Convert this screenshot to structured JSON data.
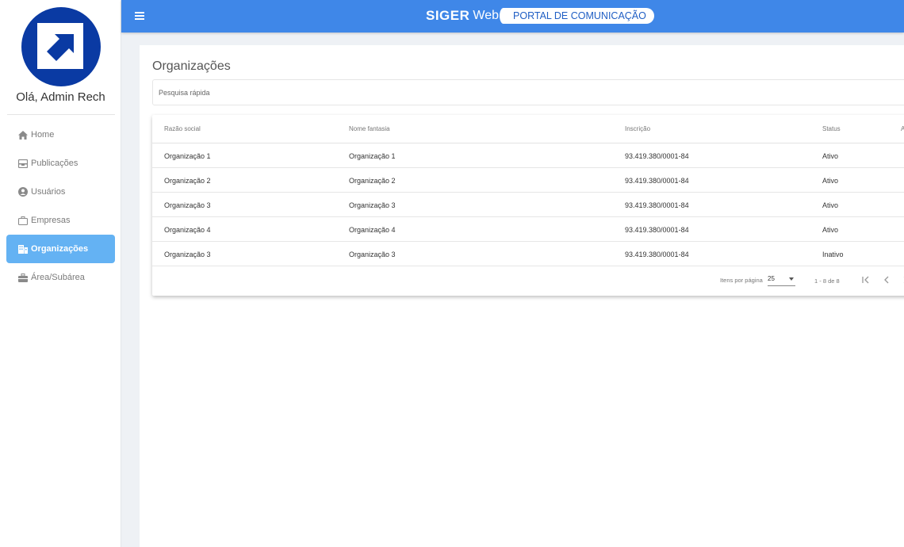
{
  "sidebar": {
    "greeting": "Olá, Admin Rech",
    "items": [
      {
        "label": "Home",
        "icon": "home-icon"
      },
      {
        "label": "Publicações",
        "icon": "inbox-icon"
      },
      {
        "label": "Usuários",
        "icon": "user-circle-icon"
      },
      {
        "label": "Empresas",
        "icon": "briefcase-icon"
      },
      {
        "label": "Organizações",
        "icon": "building-icon",
        "active": true
      },
      {
        "label": "Área/Subárea",
        "icon": "toolbox-icon"
      }
    ]
  },
  "topbar": {
    "brand_siger": "SIGER",
    "brand_web": "Web",
    "brand_portal": "PORTAL DE COMUNICAÇÃO"
  },
  "colors": {
    "topbar": "#3f87e8",
    "active_nav": "#64b2f3",
    "logo_circle": "#0a3aa3"
  },
  "page": {
    "title": "Organizações",
    "search_placeholder": "Pesquisa rápida"
  },
  "table": {
    "headers": [
      "Razão social",
      "Nome fantasia",
      "Inscrição",
      "Status",
      "A"
    ],
    "rows": [
      {
        "razao": "Organização 1",
        "fantasia": "Organização 1",
        "inscricao": "93.419.380/0001-84",
        "status": "Ativo"
      },
      {
        "razao": "Organização 2",
        "fantasia": "Organização 2",
        "inscricao": "93.419.380/0001-84",
        "status": "Ativo"
      },
      {
        "razao": "Organização 3",
        "fantasia": "Organização 3",
        "inscricao": "93.419.380/0001-84",
        "status": "Ativo"
      },
      {
        "razao": "Organização 4",
        "fantasia": "Organização 4",
        "inscricao": "93.419.380/0001-84",
        "status": "Ativo"
      },
      {
        "razao": "Organização 3",
        "fantasia": "Organização 3",
        "inscricao": "93.419.380/0001-84",
        "status": "Inativo"
      }
    ]
  },
  "pagination": {
    "per_page_label": "Itens por página",
    "per_page_value": "25",
    "range": "1 - 8 de 8"
  }
}
